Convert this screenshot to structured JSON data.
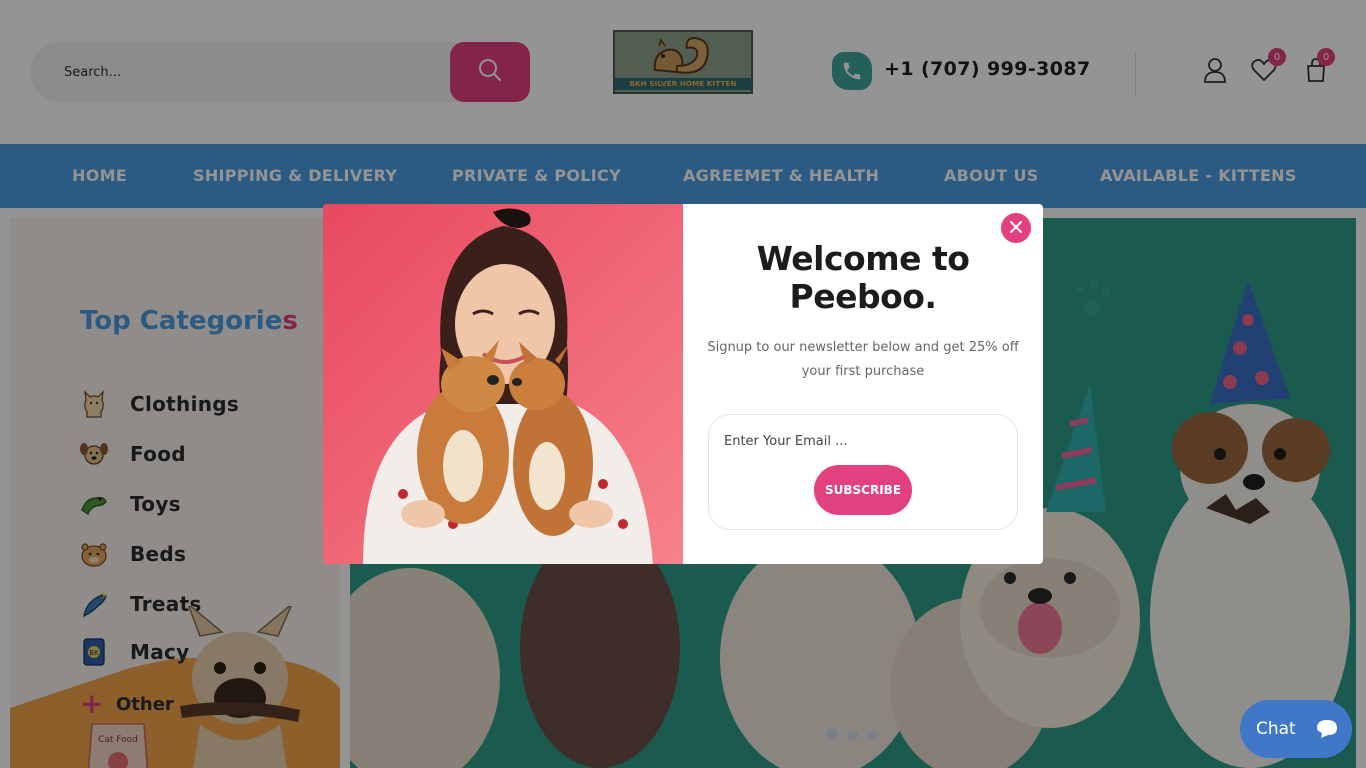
{
  "header": {
    "search": {
      "placeholder": "Search..."
    },
    "logo": {
      "text": "BKH SILVER HOME KITTEN"
    },
    "phone": {
      "number": "+1 (707) 999-3087"
    },
    "wishlist_count": "0",
    "cart_count": "0"
  },
  "nav": {
    "items": [
      {
        "label": "HOME"
      },
      {
        "label": "SHIPPING & DELIVERY"
      },
      {
        "label": "PRIVATE & POLICY"
      },
      {
        "label": "AGREEMET & HEALTH"
      },
      {
        "label": "ABOUT US"
      },
      {
        "label": "AVAILABLE - KITTENS"
      }
    ]
  },
  "sidebar": {
    "title": "Top Categorie",
    "title_last": "s",
    "categories": [
      {
        "label": "Clothings",
        "icon": "cat-icon"
      },
      {
        "label": "Food",
        "icon": "dog-icon"
      },
      {
        "label": "Toys",
        "icon": "frog-icon"
      },
      {
        "label": "Beds",
        "icon": "hamster-icon"
      },
      {
        "label": "Treats",
        "icon": "bird-icon"
      },
      {
        "label": "Macy",
        "icon": "fish-food-icon"
      }
    ],
    "other_label": "Other"
  },
  "hero": {
    "slides": 3,
    "active_slide": 1
  },
  "modal": {
    "title": "Welcome to Peeboo.",
    "subtitle": "Signup to our newsletter below and get 25% off your first purchase",
    "email_placeholder": "Enter Your Email ...",
    "subscribe_label": "SUBSCRIBE"
  },
  "chat": {
    "label": "Chat"
  },
  "colors": {
    "accent_pink": "#e2407f",
    "nav_blue": "#4a9be0",
    "hero_teal": "#2f9d88",
    "phone_teal": "#3fa69a"
  }
}
